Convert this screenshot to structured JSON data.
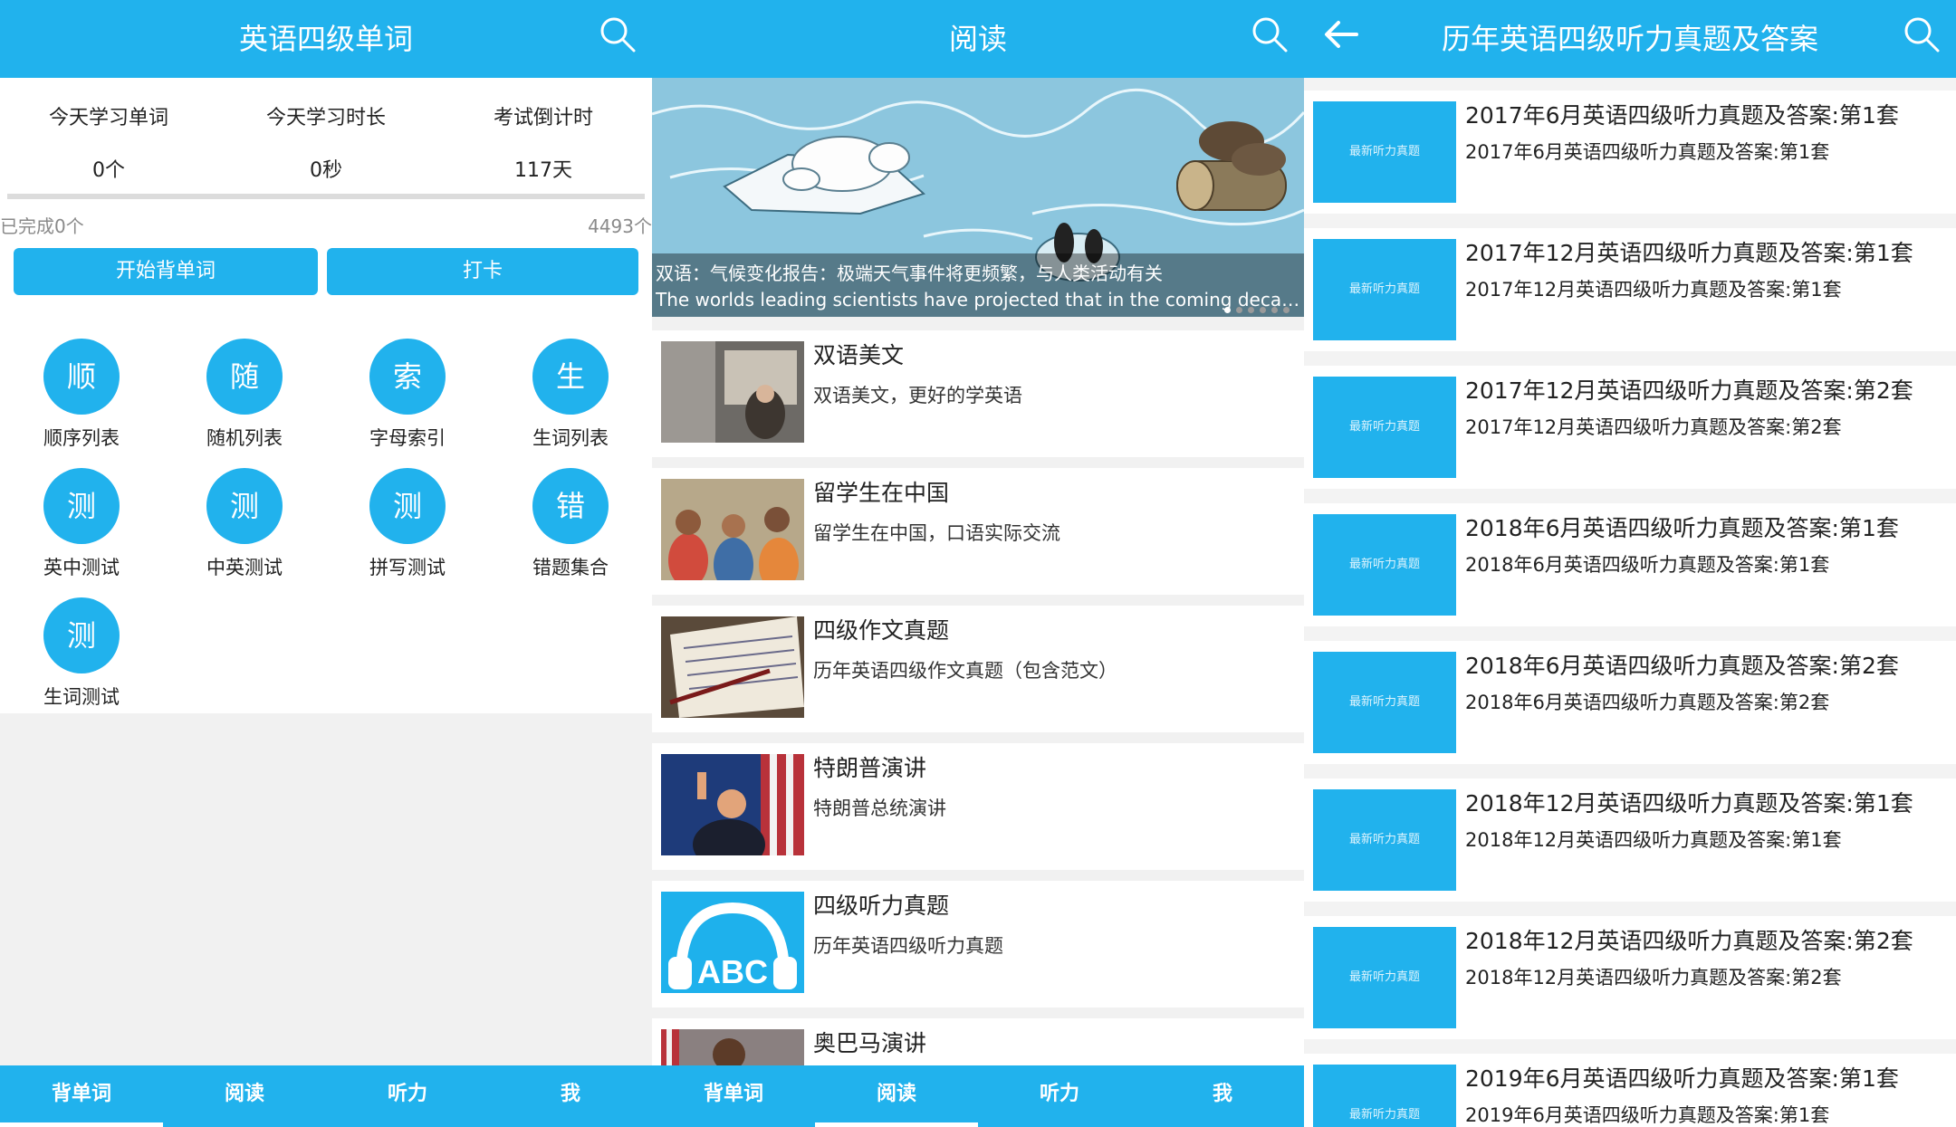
{
  "colors": {
    "accent": "#21b2ed",
    "background": "#f1f1f1"
  },
  "panel1": {
    "title": "英语四级单词",
    "stats": [
      {
        "label": "今天学习单词",
        "value": "0个"
      },
      {
        "label": "今天学习时长",
        "value": "0秒"
      },
      {
        "label": "考试倒计时",
        "value": "117天"
      }
    ],
    "progress": {
      "done": "已完成0个",
      "total": "4493个",
      "fraction": 0.0
    },
    "buttons": {
      "start": "开始背单词",
      "checkin": "打卡"
    },
    "grid": [
      {
        "char": "顺",
        "label": "顺序列表"
      },
      {
        "char": "随",
        "label": "随机列表"
      },
      {
        "char": "索",
        "label": "字母索引"
      },
      {
        "char": "生",
        "label": "生词列表"
      },
      {
        "char": "测",
        "label": "英中测试"
      },
      {
        "char": "测",
        "label": "中英测试"
      },
      {
        "char": "测",
        "label": "拼写测试"
      },
      {
        "char": "错",
        "label": "错题集合"
      },
      {
        "char": "测",
        "label": "生词测试"
      }
    ],
    "tabs": [
      "背单词",
      "阅读",
      "听力",
      "我"
    ],
    "active_tab": 0
  },
  "panel2": {
    "title": "阅读",
    "banner": {
      "line1": "双语：气候变化报告：极端天气事件将更频繁，与人类活动有关",
      "line2": "The worlds leading scientists have projected that in the coming decades, th..."
    },
    "articles": [
      {
        "title": "双语美文",
        "desc": "双语美文，更好的学英语"
      },
      {
        "title": "留学生在中国",
        "desc": "留学生在中国，口语实际交流"
      },
      {
        "title": "四级作文真题",
        "desc": "历年英语四级作文真题（包含范文）"
      },
      {
        "title": "特朗普演讲",
        "desc": "特朗普总统演讲"
      },
      {
        "title": "四级听力真题",
        "desc": "历年英语四级听力真题"
      },
      {
        "title": "奥巴马演讲",
        "desc": ""
      }
    ],
    "abc_text": "ABC",
    "tabs": [
      "背单词",
      "阅读",
      "听力",
      "我"
    ],
    "active_tab": 1
  },
  "panel3": {
    "title": "历年英语四级听力真题及答案",
    "thumb_text": "最新听力真题",
    "items": [
      {
        "title": "2017年6月英语四级听力真题及答案:第1套",
        "subtitle": "2017年6月英语四级听力真题及答案:第1套"
      },
      {
        "title": "2017年12月英语四级听力真题及答案:第1套",
        "subtitle": "2017年12月英语四级听力真题及答案:第1套"
      },
      {
        "title": "2017年12月英语四级听力真题及答案:第2套",
        "subtitle": "2017年12月英语四级听力真题及答案:第2套"
      },
      {
        "title": "2018年6月英语四级听力真题及答案:第1套",
        "subtitle": "2018年6月英语四级听力真题及答案:第1套"
      },
      {
        "title": "2018年6月英语四级听力真题及答案:第2套",
        "subtitle": "2018年6月英语四级听力真题及答案:第2套"
      },
      {
        "title": "2018年12月英语四级听力真题及答案:第1套",
        "subtitle": "2018年12月英语四级听力真题及答案:第1套"
      },
      {
        "title": "2018年12月英语四级听力真题及答案:第2套",
        "subtitle": "2018年12月英语四级听力真题及答案:第2套"
      },
      {
        "title": "2019年6月英语四级听力真题及答案:第1套",
        "subtitle": "2019年6月英语四级听力真题及答案:第1套"
      }
    ]
  }
}
